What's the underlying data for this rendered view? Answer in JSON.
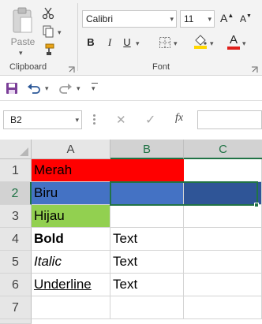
{
  "ribbon": {
    "clipboard": {
      "paste_label": "Paste",
      "group_label": "Clipboard"
    },
    "font": {
      "font_name": "Calibri",
      "font_size": "11",
      "group_label": "Font",
      "bold_label": "B",
      "italic_label": "I",
      "underline_label": "U",
      "grow_label": "A",
      "shrink_label": "A",
      "font_color_label": "A",
      "fill_color": "#ffd700",
      "font_color": "#e0201b"
    }
  },
  "formula_bar": {
    "name_box": "B2",
    "fx_label": "fx",
    "formula": ""
  },
  "grid": {
    "columns": [
      "A",
      "B",
      "C"
    ],
    "rows": [
      "1",
      "2",
      "3",
      "4",
      "5",
      "6",
      "7"
    ],
    "cells": {
      "A1": "Merah",
      "A2": "Biru",
      "A3": "Hijau",
      "A4": "Bold",
      "A5": "Italic",
      "A6": "Underline",
      "B5": "Text",
      "B6": "Text",
      "B4": "Text"
    },
    "selected_cell": "B2",
    "colors": {
      "red_fill": "#ff0000",
      "blue_fill": "#4472c4",
      "green_fill": "#92d050",
      "selection": "#217346"
    }
  }
}
